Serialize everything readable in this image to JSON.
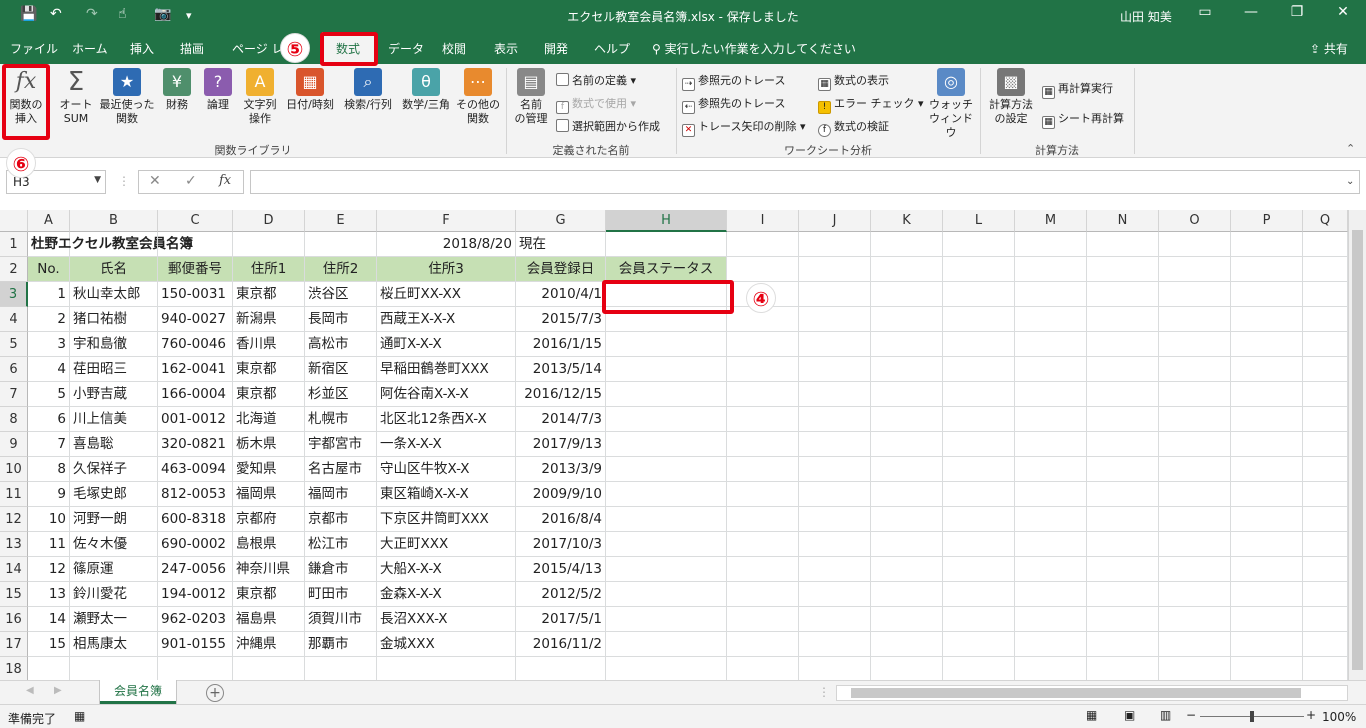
{
  "titlebar": {
    "title": "エクセル教室会員名簿.xlsx  -  保存しました",
    "user": "山田 知美",
    "save_icon": "save-icon",
    "undo_icon": "undo-icon",
    "redo_icon": "redo-icon",
    "touch_icon": "touch-mode-icon",
    "camera_icon": "camera-icon"
  },
  "tabs": [
    "ファイル",
    "ホーム",
    "挿入",
    "描画",
    "ページ レ",
    "数式",
    "データ",
    "校閲",
    "表示",
    "開発",
    "ヘルプ"
  ],
  "active_tab": "数式",
  "tellme": "実行したい作業を入力してください",
  "share": "共有",
  "ribbon": {
    "insert_function": [
      "関数の",
      "挿入"
    ],
    "autosum": [
      "オート",
      "SUM"
    ],
    "recent": [
      "最近使った",
      "関数"
    ],
    "financial": "財務",
    "logical": "論理",
    "text": [
      "文字列",
      "操作"
    ],
    "datetime": "日付/時刻",
    "lookup": "検索/行列",
    "math": "数学/三角",
    "more": [
      "その他の",
      "関数"
    ],
    "group_library": "関数ライブラリ",
    "name_manager": [
      "名前",
      "の管理"
    ],
    "define_name": "名前の定義",
    "use_in_formula": "数式で使用",
    "create_from_selection": "選択範囲から作成",
    "group_names": "定義された名前",
    "trace_precedents": "参照元のトレース",
    "trace_dependents": "参照先のトレース",
    "remove_arrows": "トレース矢印の削除",
    "show_formulas": "数式の表示",
    "error_checking": "エラー チェック",
    "evaluate_formula": "数式の検証",
    "watch_window": [
      "ウォッチ",
      "ウィンドウ"
    ],
    "group_audit": "ワークシート分析",
    "calc_options": [
      "計算方法",
      "の設定"
    ],
    "calc_now": "再計算実行",
    "calc_sheet": "シート再計算",
    "group_calc": "計算方法"
  },
  "formula_bar": {
    "name_box": "H3",
    "fx_label": "fx",
    "formula": ""
  },
  "columns": [
    "A",
    "B",
    "C",
    "D",
    "E",
    "F",
    "G",
    "H",
    "I",
    "J",
    "K",
    "L",
    "M",
    "N",
    "O",
    "P",
    "Q"
  ],
  "selected_column": "H",
  "selected_row": "3",
  "sheet": {
    "title": "杜野エクセル教室会員名簿",
    "date": "2018/8/20",
    "date_suffix": "現在",
    "headers": [
      "No.",
      "氏名",
      "郵便番号",
      "住所1",
      "住所2",
      "住所3",
      "会員登録日",
      "会員ステータス"
    ],
    "rows": [
      [
        "1",
        "秋山幸太郎",
        "150-0031",
        "東京都",
        "渋谷区",
        "桜丘町XX-XX",
        "2010/4/1"
      ],
      [
        "2",
        "猪口祐樹",
        "940-0027",
        "新潟県",
        "長岡市",
        "西蔵王X-X-X",
        "2015/7/3"
      ],
      [
        "3",
        "宇和島徹",
        "760-0046",
        "香川県",
        "高松市",
        "通町X-X-X",
        "2016/1/15"
      ],
      [
        "4",
        "荏田昭三",
        "162-0041",
        "東京都",
        "新宿区",
        "早稲田鶴巻町XXX",
        "2013/5/14"
      ],
      [
        "5",
        "小野吉蔵",
        "166-0004",
        "東京都",
        "杉並区",
        "阿佐谷南X-X-X",
        "2016/12/15"
      ],
      [
        "6",
        "川上信美",
        "001-0012",
        "北海道",
        "札幌市",
        "北区北12条西X-X",
        "2014/7/3"
      ],
      [
        "7",
        "喜島聡",
        "320-0821",
        "栃木県",
        "宇都宮市",
        "一条X-X-X",
        "2017/9/13"
      ],
      [
        "8",
        "久保祥子",
        "463-0094",
        "愛知県",
        "名古屋市",
        "守山区牛牧X-X",
        "2013/3/9"
      ],
      [
        "9",
        "毛塚史郎",
        "812-0053",
        "福岡県",
        "福岡市",
        "東区箱崎X-X-X",
        "2009/9/10"
      ],
      [
        "10",
        "河野一朗",
        "600-8318",
        "京都府",
        "京都市",
        "下京区井筒町XXX",
        "2016/8/4"
      ],
      [
        "11",
        "佐々木優",
        "690-0002",
        "島根県",
        "松江市",
        "大正町XXX",
        "2017/10/3"
      ],
      [
        "12",
        "篠原運",
        "247-0056",
        "神奈川県",
        "鎌倉市",
        "大船X-X-X",
        "2015/4/13"
      ],
      [
        "13",
        "鈴川愛花",
        "194-0012",
        "東京都",
        "町田市",
        "金森X-X-X",
        "2012/5/2"
      ],
      [
        "14",
        "瀬野太一",
        "962-0203",
        "福島県",
        "須賀川市",
        "長沼XXX-X",
        "2017/5/1"
      ],
      [
        "15",
        "相馬康太",
        "901-0155",
        "沖縄県",
        "那覇市",
        "金城XXX",
        "2016/11/2"
      ]
    ]
  },
  "sheet_tab": "会員名簿",
  "status": "準備完了",
  "zoom": "100%",
  "annotations": {
    "step4": "④",
    "step5": "⑤",
    "step6": "⑥"
  },
  "colors": {
    "excel_green": "#217346",
    "header_fill": "#c6e0b4",
    "annotation_red": "#e60012"
  }
}
